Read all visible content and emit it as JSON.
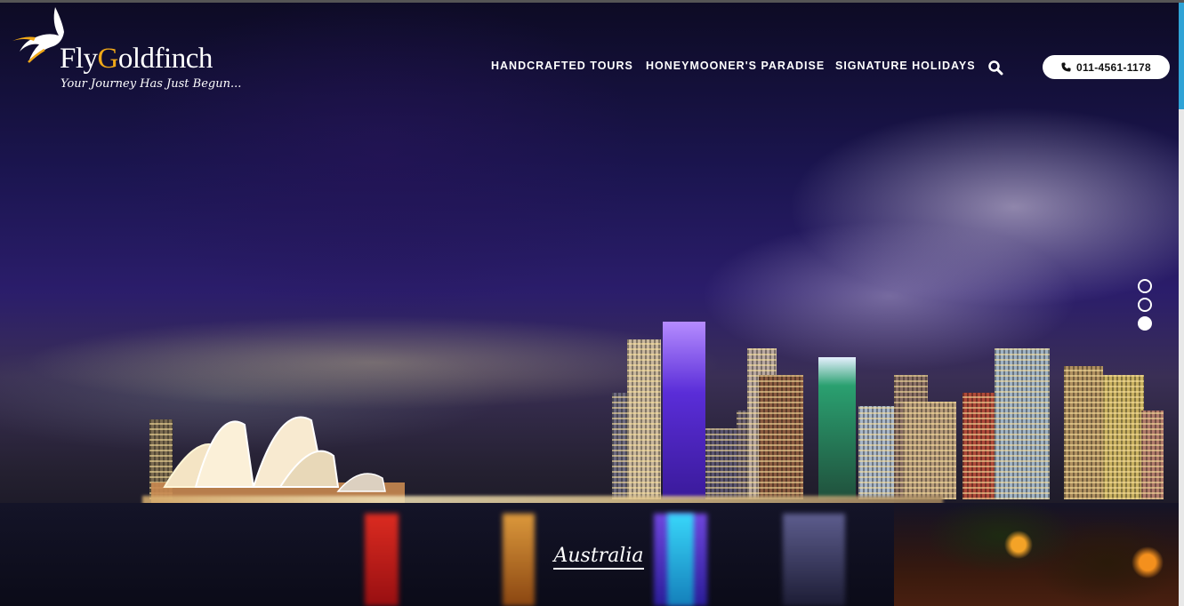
{
  "brand": {
    "name_part1": "Fly",
    "name_g": "G",
    "name_part2": "oldfinch",
    "tagline": "Your Journey Has Just Begun..."
  },
  "nav": {
    "items": [
      {
        "label": "HANDCRAFTED TOURS"
      },
      {
        "label": "HONEYMOONER'S PARADISE"
      },
      {
        "label": "SIGNATURE HOLIDAYS"
      }
    ],
    "search_icon": "search-icon",
    "phone": {
      "icon": "phone-icon",
      "number": "011-4561-1178"
    }
  },
  "hero": {
    "caption": "Australia",
    "slides_total": 3,
    "active_slide": 3
  },
  "colors": {
    "brand_gold": "#f0a818",
    "scroll_accent": "#2fa3d6",
    "text_light": "#ffffff"
  }
}
